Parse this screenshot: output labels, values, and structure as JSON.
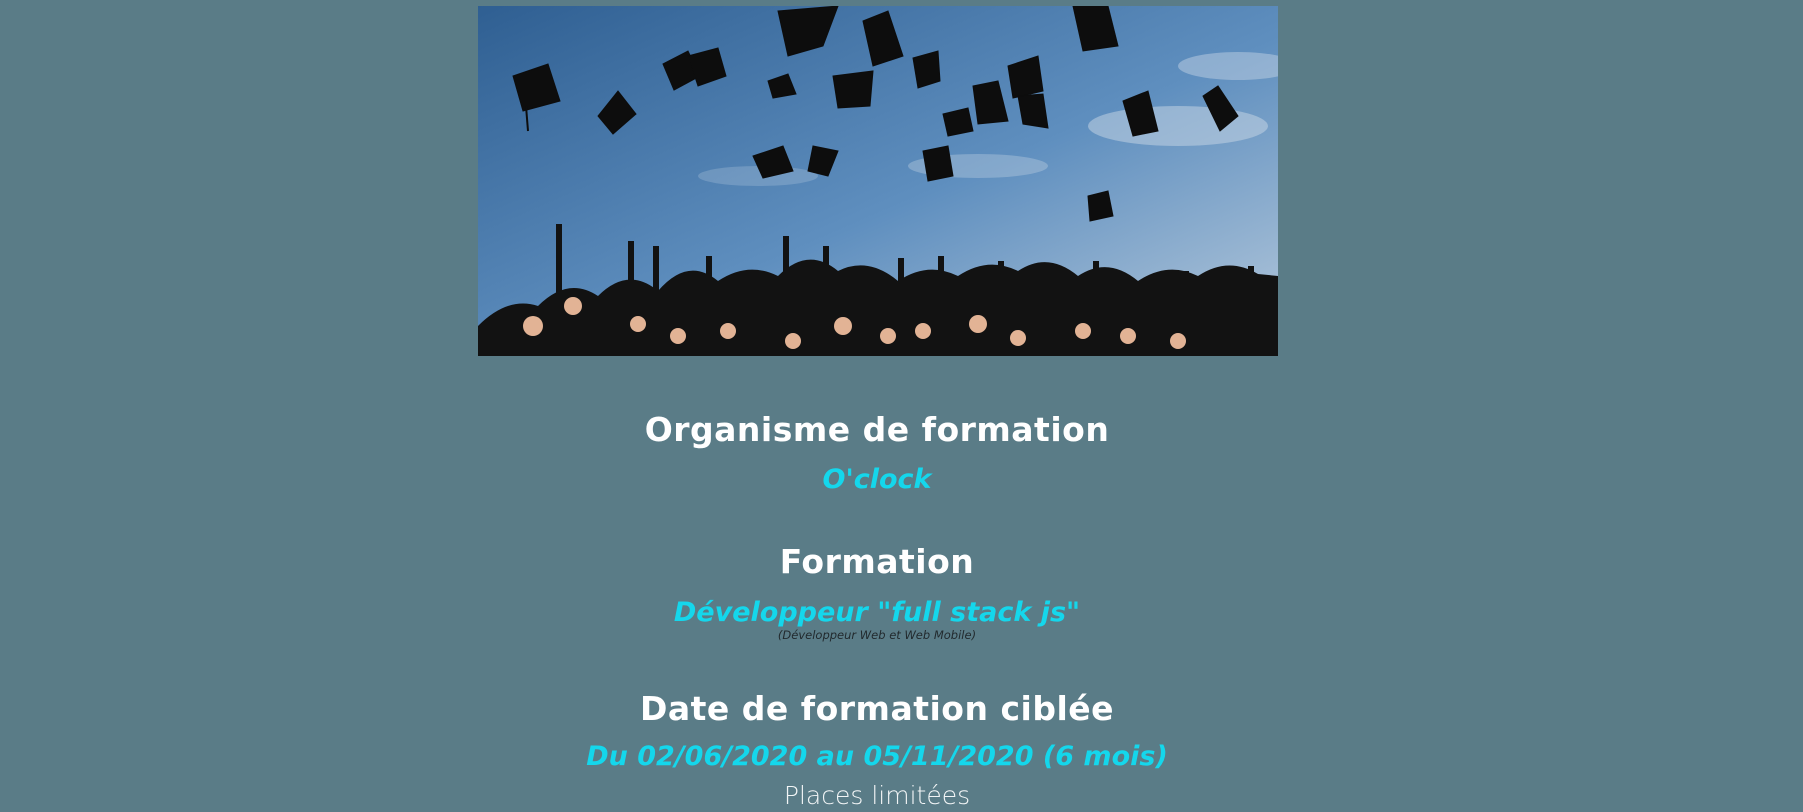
{
  "hero_image": {
    "alt": "Graduation caps thrown in the air",
    "colors": {
      "sky_top": "#3e6f9f",
      "sky_bottom": "#9fbcd6",
      "gown": "#111111"
    }
  },
  "sections": [
    {
      "heading": "Organisme de formation",
      "value": "O'clock"
    },
    {
      "heading": "Formation",
      "value": "Développeur \"full stack js\"",
      "sub": "(Développeur Web et Web Mobile)"
    },
    {
      "heading": "Date de formation ciblée",
      "value": "Du 02/06/2020 au 05/11/2020 (6 mois)",
      "note": "Places limitées"
    }
  ],
  "colors": {
    "background": "#5a7c87",
    "heading": "#ffffff",
    "accent": "#14d7ec"
  }
}
